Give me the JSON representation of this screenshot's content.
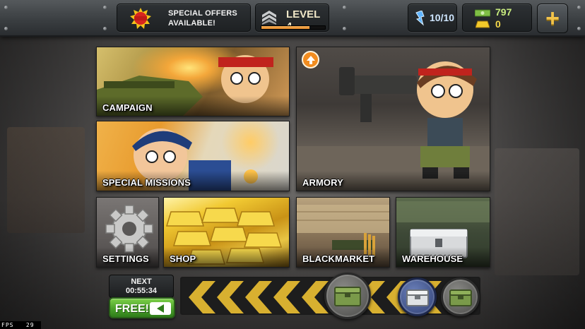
{
  "topbar": {
    "offers": {
      "line1": "SPECIAL OFFERS",
      "line2": "AVAILABLE!",
      "badge_text": "SPECIAL OFFERS"
    },
    "level": {
      "label": "LEVEL 4",
      "progress": 0.75
    },
    "energy": {
      "value": "10/10"
    },
    "cash": {
      "value": "797"
    },
    "gold": {
      "value": "0"
    },
    "plus_label": "+"
  },
  "menu": {
    "campaign": "CAMPAIGN",
    "special_missions": "SPECIAL MISSIONS",
    "armory": "ARMORY",
    "settings": "SETTINGS",
    "shop": "SHOP",
    "blackmarket": "BLACKMARKET",
    "warehouse": "WAREHOUSE"
  },
  "reward": {
    "next_label": "NEXT",
    "timer": "00:55:34",
    "free_label": "FREE!"
  },
  "fps": {
    "label": "FPS",
    "value": "29"
  },
  "colors": {
    "accent_orange": "#f18c20",
    "free_green": "#4aa02a",
    "gold": "#f5d84a",
    "cash_green": "#c8ec7e"
  },
  "icons": [
    "special-offer-icon",
    "rank-chevron-icon",
    "energy-icon",
    "cash-icon",
    "gold-icon",
    "plus-icon",
    "upgrade-arrow-icon",
    "gear-icon",
    "play-arrow-icon",
    "crate-icon"
  ]
}
